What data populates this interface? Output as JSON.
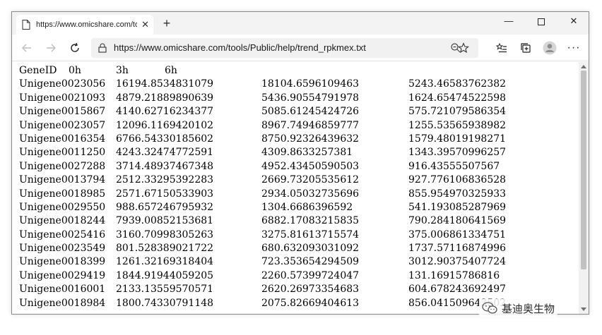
{
  "browser": {
    "tab_title": "https://www.omicshare.com/too",
    "url": "https://www.omicshare.com/tools/Public/help/trend_rpkmex.txt"
  },
  "file": {
    "header": [
      "GeneID",
      "0h",
      "3h",
      "6h"
    ],
    "rows": [
      [
        "Unigene0023056",
        "16194.8534831079",
        "18104.6596109463",
        "5243.46583762382"
      ],
      [
        "Unigene0021093",
        "4879.21889890639",
        "5436.90554791978",
        "1624.65474522598"
      ],
      [
        "Unigene0015867",
        "4140.62716234377",
        "5085.61245424726",
        "575.721079586354"
      ],
      [
        "Unigene0023057",
        "12096.1169420102",
        "8967.74946859777",
        "1255.53565938982"
      ],
      [
        "Unigene0016354",
        "6766.54330185602",
        "8750.92326439632",
        "1579.48019198271"
      ],
      [
        "Unigene0011250",
        "4243.32474772591",
        "4309.8633257381",
        "1343.39570996257"
      ],
      [
        "Unigene0027288",
        "3714.48937467348",
        "4952.43450590503",
        "916.43555507567"
      ],
      [
        "Unigene0013794",
        "2512.33295392283",
        "2669.73205535612",
        "927.776106836528"
      ],
      [
        "Unigene0018985",
        "2571.67150533903",
        "2934.05032735696",
        "855.954970325933"
      ],
      [
        "Unigene0029550",
        "988.657246795932",
        "1304.6686396592",
        "541.193085287969"
      ],
      [
        "Unigene0018244",
        "7939.00852153681",
        "6882.17083215835",
        "790.284180641569"
      ],
      [
        "Unigene0025416",
        "3160.70998305263",
        "3275.81613715574",
        "375.006861334751"
      ],
      [
        "Unigene0023549",
        "801.528389021722",
        "680.632093031092",
        "1737.57116874996"
      ],
      [
        "Unigene0018399",
        "1261.32169318404",
        "723.353654294509",
        "3012.90375407724"
      ],
      [
        "Unigene0029419",
        "1844.91944059205",
        "2260.57399724047",
        "131.16915786816"
      ],
      [
        "Unigene0016001",
        "2133.13559570571",
        "2620.26973354683",
        "604.678243692497"
      ],
      [
        "Unigene0018984",
        "1800.74330791148",
        "2075.82669404613",
        "856.041509643502"
      ]
    ]
  },
  "watermark": {
    "text": "基迪奥生物"
  }
}
